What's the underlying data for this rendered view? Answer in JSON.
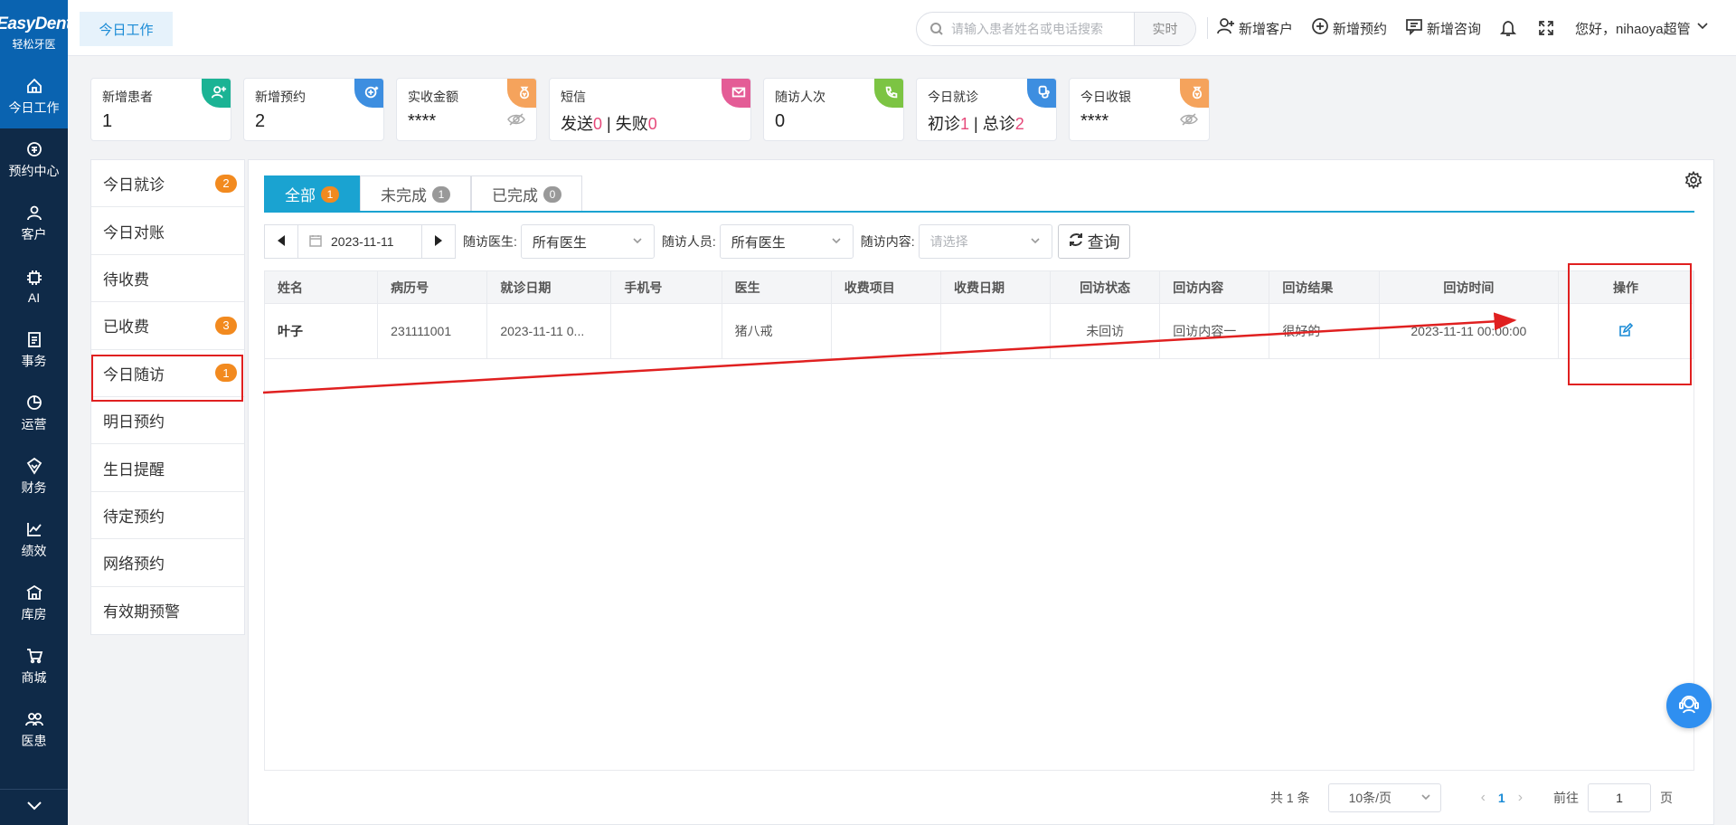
{
  "app": {
    "logo_text": "EasyDent",
    "logo_sub": "轻松牙医"
  },
  "nav": {
    "items": [
      {
        "label": "今日工作",
        "icon": "home-icon"
      },
      {
        "label": "预约中心",
        "icon": "calendar-icon"
      },
      {
        "label": "客户",
        "icon": "user-icon"
      },
      {
        "label": "AI",
        "icon": "ai-chip-icon"
      },
      {
        "label": "事务",
        "icon": "clipboard-icon"
      },
      {
        "label": "运营",
        "icon": "pie-chart-icon"
      },
      {
        "label": "财务",
        "icon": "finance-icon"
      },
      {
        "label": "绩效",
        "icon": "line-chart-icon"
      },
      {
        "label": "库房",
        "icon": "warehouse-icon"
      },
      {
        "label": "商城",
        "icon": "cart-icon"
      },
      {
        "label": "医患",
        "icon": "doctor-patient-icon"
      }
    ]
  },
  "header": {
    "tab_label": "今日工作",
    "search_placeholder": "请输入患者姓名或电话搜索",
    "search_mode": "实时",
    "actions": [
      "新增客户",
      "新增预约",
      "新增咨询"
    ],
    "user_greeting": "您好，nihaoya超管"
  },
  "cards": [
    {
      "title": "新增患者",
      "value": "1",
      "color": "#1bb394",
      "icon": "user-add-icon"
    },
    {
      "title": "新增预约",
      "value": "2",
      "color": "#3d8ee0",
      "icon": "appointment-add-icon"
    },
    {
      "title": "实收金额",
      "value": "****",
      "color": "#f5a35c",
      "icon": "money-bag-icon"
    },
    {
      "title": "短信",
      "sent_label": "发送",
      "sent": "0",
      "fail_label": "失败",
      "fail": "0",
      "color": "#e45c96",
      "icon": "mail-icon"
    },
    {
      "title": "随访人次",
      "value": "0",
      "color": "#7cc443",
      "icon": "phone-followup-icon"
    },
    {
      "title": "今日就诊",
      "first_label": "初诊",
      "first": "1",
      "total_label": "总诊",
      "total": "2",
      "color": "#3d8ee0",
      "icon": "medical-icon"
    },
    {
      "title": "今日收银",
      "value": "****",
      "color": "#f5a35c",
      "icon": "cashier-icon"
    }
  ],
  "submenu": [
    {
      "label": "今日就诊",
      "badge": "2"
    },
    {
      "label": "今日对账",
      "badge": ""
    },
    {
      "label": "待收费",
      "badge": ""
    },
    {
      "label": "已收费",
      "badge": "3"
    },
    {
      "label": "今日随访",
      "badge": "1"
    },
    {
      "label": "明日预约",
      "badge": ""
    },
    {
      "label": "生日提醒",
      "badge": ""
    },
    {
      "label": "待定预约",
      "badge": ""
    },
    {
      "label": "网络预约",
      "badge": ""
    },
    {
      "label": "有效期预警",
      "badge": ""
    }
  ],
  "tabs": [
    {
      "label": "全部",
      "count": "1"
    },
    {
      "label": "未完成",
      "count": "1"
    },
    {
      "label": "已完成",
      "count": "0"
    }
  ],
  "filters": {
    "date": "2023-11-11",
    "doctor_label": "随访医生:",
    "doctor_value": "所有医生",
    "staff_label": "随访人员:",
    "staff_value": "所有医生",
    "content_label": "随访内容:",
    "content_placeholder": "请选择",
    "query_button": "查询"
  },
  "table": {
    "columns": [
      "姓名",
      "病历号",
      "就诊日期",
      "手机号",
      "医生",
      "收费项目",
      "收费日期",
      "回访状态",
      "回访内容",
      "回访结果",
      "回访时间",
      "操作"
    ],
    "rows": [
      [
        "叶子",
        "231111001",
        "2023-11-11 0...",
        "",
        "猪八戒",
        "",
        "",
        "未回访",
        "回访内容一",
        "很好的",
        "2023-11-11 00:00:00",
        ""
      ]
    ]
  },
  "pager": {
    "total": "共 1 条",
    "page_size": "10条/页",
    "current": "1",
    "goto_label": "前往",
    "goto_value": "1",
    "page_suffix": "页"
  }
}
